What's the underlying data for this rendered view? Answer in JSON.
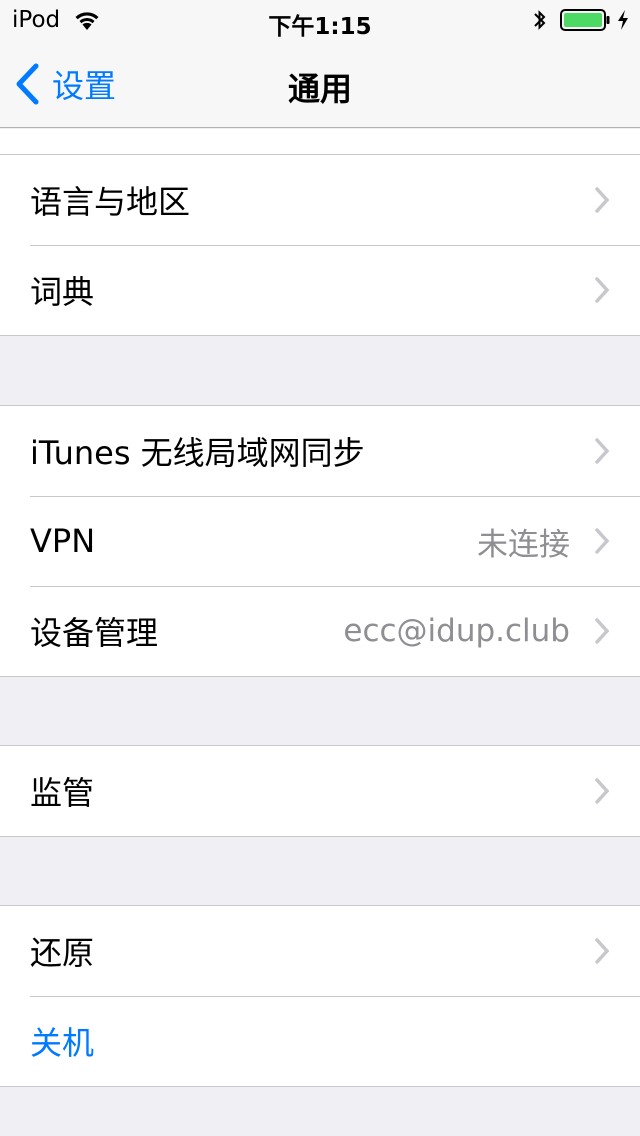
{
  "status_bar": {
    "carrier": "iPod",
    "time": "下午1:15",
    "battery_color": "#4cd964"
  },
  "nav": {
    "back_label": "设置",
    "title": "通用",
    "accent": "#007aff"
  },
  "section1": {
    "rows": [
      {
        "label": "语言与地区",
        "value": ""
      },
      {
        "label": "词典",
        "value": ""
      }
    ]
  },
  "section2": {
    "rows": [
      {
        "label": "iTunes 无线局域网同步",
        "value": ""
      },
      {
        "label": "VPN",
        "value": "未连接"
      },
      {
        "label": "设备管理",
        "value": "ecc@idup.club"
      }
    ]
  },
  "section3": {
    "rows": [
      {
        "label": "监管",
        "value": ""
      }
    ]
  },
  "section4": {
    "rows": [
      {
        "label": "还原",
        "value": ""
      },
      {
        "label": "关机",
        "value": ""
      }
    ]
  }
}
